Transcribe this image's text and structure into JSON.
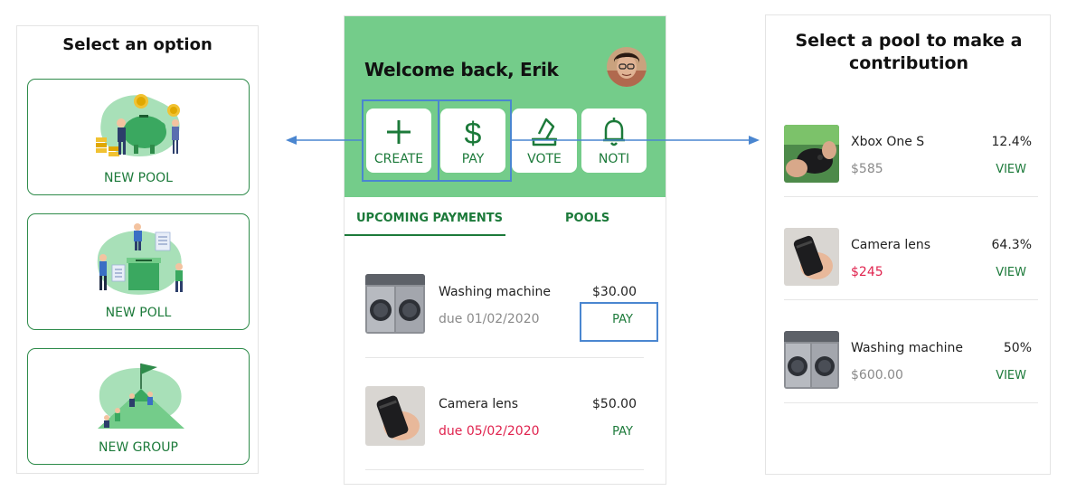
{
  "left_panel": {
    "title": "Select an option",
    "options": [
      {
        "label": "NEW POOL",
        "icon": "piggy-bank-illustration"
      },
      {
        "label": "NEW POLL",
        "icon": "ballot-box-illustration"
      },
      {
        "label": "NEW GROUP",
        "icon": "flag-mountain-illustration"
      }
    ]
  },
  "phone": {
    "welcome": "Welcome back, Erik",
    "actions": [
      {
        "label": "CREATE",
        "icon": "plus-icon"
      },
      {
        "label": "PAY",
        "icon": "dollar-icon"
      },
      {
        "label": "VOTE",
        "icon": "ballot-icon"
      },
      {
        "label": "NOTI",
        "icon": "bell-icon"
      }
    ],
    "tabs": [
      {
        "label": "UPCOMING PAYMENTS",
        "active": true
      },
      {
        "label": "POOLS",
        "active": false
      }
    ],
    "payments": [
      {
        "name": "Washing machine",
        "due": "due 01/02/2020",
        "amount": "$30.00",
        "action": "PAY",
        "due_color": "#8a8a8a"
      },
      {
        "name": "Camera lens",
        "due": "due 05/02/2020",
        "amount": "$50.00",
        "action": "PAY",
        "due_color": "#e0234e"
      }
    ]
  },
  "right_panel": {
    "title": "Select a pool to make a contribution",
    "pools": [
      {
        "name": "Xbox One S",
        "amount": "$585",
        "percent": "12.4%",
        "action": "VIEW",
        "amount_color": "#8a8a8a"
      },
      {
        "name": "Camera lens",
        "amount": "$245",
        "percent": "64.3%",
        "action": "VIEW",
        "amount_color": "#e0234e"
      },
      {
        "name": "Washing machine",
        "amount": "$600.00",
        "percent": "50%",
        "action": "VIEW",
        "amount_color": "#8a8a8a"
      }
    ]
  },
  "colors": {
    "brand_green": "#74cc8a",
    "text_green": "#1c7a3a",
    "highlight_blue": "#4a86d0",
    "alert_red": "#e0234e"
  }
}
